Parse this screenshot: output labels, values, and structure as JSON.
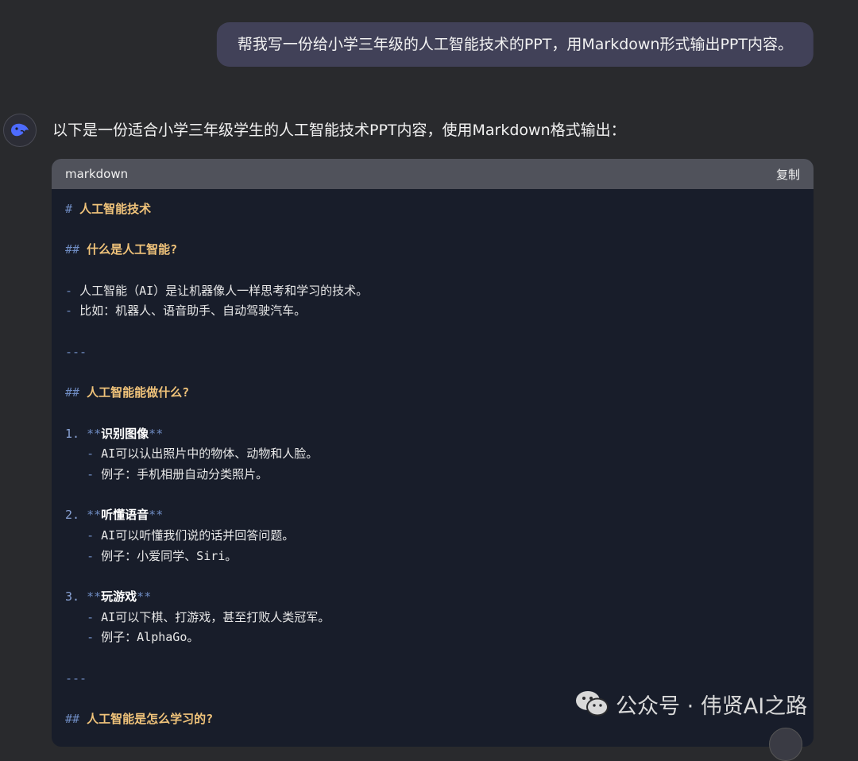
{
  "user_message": "帮我写一份给小学三年级的人工智能技术的PPT，用Markdown形式输出PPT内容。",
  "assistant": {
    "intro": "以下是一份适合小学三年级学生的人工智能技术PPT内容，使用Markdown格式输出：",
    "avatar_icon": "whale-logo-icon"
  },
  "code_block": {
    "language": "markdown",
    "copy_label": "复制",
    "lines": [
      {
        "t": "h1",
        "mark": "#",
        "text": "人工智能技术"
      },
      {
        "t": "blank"
      },
      {
        "t": "h2",
        "mark": "##",
        "text": "什么是人工智能?"
      },
      {
        "t": "blank"
      },
      {
        "t": "li",
        "indent": "",
        "mark": "-",
        "text": "人工智能（AI）是让机器像人一样思考和学习的技术。"
      },
      {
        "t": "li",
        "indent": "",
        "mark": "-",
        "text": "比如：机器人、语音助手、自动驾驶汽车。"
      },
      {
        "t": "blank"
      },
      {
        "t": "hr",
        "mark": "---"
      },
      {
        "t": "blank"
      },
      {
        "t": "h2",
        "mark": "##",
        "text": "人工智能能做什么?"
      },
      {
        "t": "blank"
      },
      {
        "t": "ol",
        "num": "1.",
        "text": "识别图像"
      },
      {
        "t": "li",
        "indent": "   ",
        "mark": "-",
        "text": "AI可以认出照片中的物体、动物和人脸。"
      },
      {
        "t": "li",
        "indent": "   ",
        "mark": "-",
        "text": "例子：手机相册自动分类照片。"
      },
      {
        "t": "blank"
      },
      {
        "t": "ol",
        "num": "2.",
        "text": "听懂语音"
      },
      {
        "t": "li",
        "indent": "   ",
        "mark": "-",
        "text": "AI可以听懂我们说的话并回答问题。"
      },
      {
        "t": "li",
        "indent": "   ",
        "mark": "-",
        "text": "例子：小爱同学、Siri。"
      },
      {
        "t": "blank"
      },
      {
        "t": "ol",
        "num": "3.",
        "text": "玩游戏"
      },
      {
        "t": "li",
        "indent": "   ",
        "mark": "-",
        "text": "AI可以下棋、打游戏，甚至打败人类冠军。"
      },
      {
        "t": "li",
        "indent": "   ",
        "mark": "-",
        "text": "例子：AlphaGo。"
      },
      {
        "t": "blank"
      },
      {
        "t": "hr",
        "mark": "---"
      },
      {
        "t": "blank"
      },
      {
        "t": "h2",
        "mark": "##",
        "text": "人工智能是怎么学习的?"
      }
    ]
  },
  "watermark": {
    "icon": "wechat-icon",
    "text": "公众号 · 伟贤AI之路"
  }
}
